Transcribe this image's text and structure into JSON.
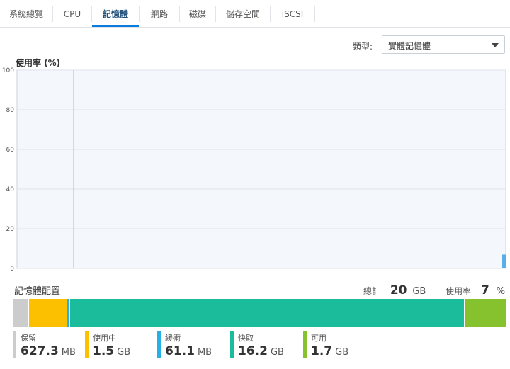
{
  "tabs": [
    {
      "label": "系統總覽",
      "active": false
    },
    {
      "label": "CPU",
      "active": false
    },
    {
      "label": "記憶體",
      "active": true
    },
    {
      "label": "網路",
      "active": false
    },
    {
      "label": "磁碟",
      "active": false
    },
    {
      "label": "儲存空間",
      "active": false
    },
    {
      "label": "iSCSI",
      "active": false
    }
  ],
  "type_selector": {
    "label": "類型:",
    "value": "實體記憶體"
  },
  "usage_chart": {
    "title": "使用率 (%)",
    "chart_data": {
      "type": "area",
      "y_ticks": [
        "100",
        "80",
        "60",
        "40",
        "20",
        "0"
      ],
      "ylim": [
        0,
        100
      ],
      "grid": true,
      "series": [
        {
          "values": [
            7
          ]
        }
      ]
    }
  },
  "allocation": {
    "title": "記憶體配置",
    "total_label": "總計",
    "total_value": "20",
    "total_unit": "GB",
    "usage_label": "使用率",
    "usage_value": "7",
    "usage_unit": "%",
    "segments": [
      {
        "name": "reserved",
        "fraction": 0.033,
        "color": "#cccccc"
      },
      {
        "name": "used",
        "fraction": 0.0775,
        "color": "#fcc000"
      },
      {
        "name": "buffer",
        "fraction": 0.005,
        "color": "#28b0e6"
      },
      {
        "name": "cache",
        "fraction": 0.8,
        "color": "#1abc9c"
      },
      {
        "name": "available",
        "fraction": 0.0845,
        "color": "#85c22d"
      }
    ],
    "legend": [
      {
        "label": "保留",
        "value": "627.3",
        "unit": "MB",
        "color": "#cccccc"
      },
      {
        "label": "使用中",
        "value": "1.5",
        "unit": "GB",
        "color": "#fcc000"
      },
      {
        "label": "緩衝",
        "value": "61.1",
        "unit": "MB",
        "color": "#28b0e6"
      },
      {
        "label": "快取",
        "value": "16.2",
        "unit": "GB",
        "color": "#1abc9c"
      },
      {
        "label": "可用",
        "value": "1.7",
        "unit": "GB",
        "color": "#85c22d"
      }
    ]
  }
}
